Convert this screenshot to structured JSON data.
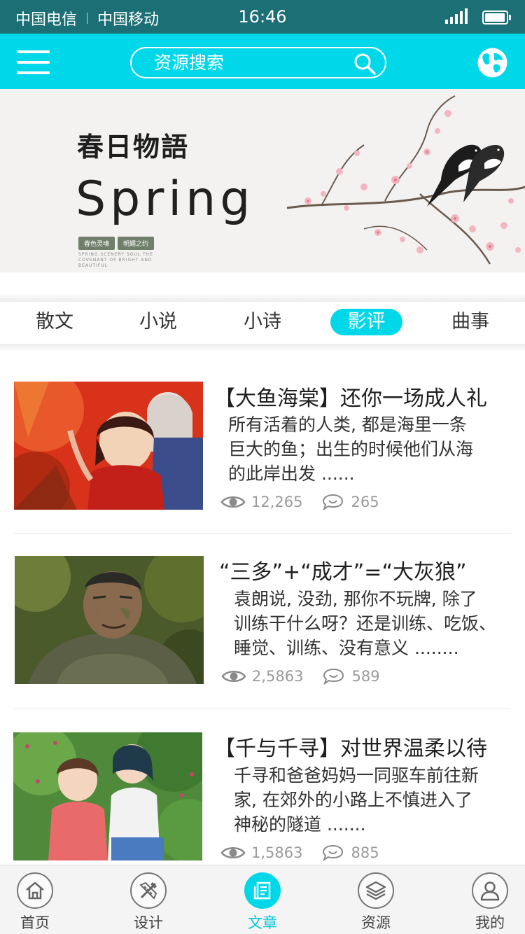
{
  "status_bar": {
    "carrier1": "中国电信",
    "carrier2": "中国移动",
    "time": "16:46",
    "icons": [
      "signal-icon",
      "battery-icon"
    ]
  },
  "header": {
    "search_placeholder": "资源搜索",
    "icons": [
      "menu-icon",
      "search-icon",
      "globe-icon"
    ],
    "accent_color": "#00d8ea"
  },
  "banner": {
    "title_cn": "春日物語",
    "title_en": "Spring",
    "tags": [
      "春色灵魂",
      "明媚之约"
    ],
    "small_text": "SPRING SCENERY SOUL THE COVENANT OF BRIGHT AND BEAUTIFUL"
  },
  "tabs": [
    {
      "label": "散文",
      "active": false
    },
    {
      "label": "小说",
      "active": false
    },
    {
      "label": "小诗",
      "active": false
    },
    {
      "label": "影评",
      "active": true
    },
    {
      "label": "曲事",
      "active": false
    }
  ],
  "articles": [
    {
      "title": "【大鱼海棠】还你一场成人礼",
      "desc": [
        "所有活着的人类, 都是海里一条",
        "巨大的鱼；出生的时候他们从海",
        "的此岸出发 ......"
      ],
      "views": "12,265",
      "comments": "265"
    },
    {
      "title": "“三多”+“成才”=“大灰狼”",
      "desc": [
        "袁朗说, 没劲, 那你不玩牌, 除了",
        "训练干什么呀？还是训练、吃饭、",
        "睡觉、训练、没有意义 ........"
      ],
      "views": "2,5863",
      "comments": "589"
    },
    {
      "title": "【千与千寻】对世界温柔以待",
      "desc": [
        "千寻和爸爸妈妈一同驱车前往新",
        "家, 在郊外的小路上不慎进入了",
        "神秘的隧道 ......."
      ],
      "views": "1,5863",
      "comments": "885"
    }
  ],
  "bottom_nav": [
    {
      "label": "首页",
      "icon": "home-icon",
      "active": false
    },
    {
      "label": "设计",
      "icon": "design-icon",
      "active": false
    },
    {
      "label": "文章",
      "icon": "article-icon",
      "active": true
    },
    {
      "label": "资源",
      "icon": "layers-icon",
      "active": false
    },
    {
      "label": "我的",
      "icon": "user-icon",
      "active": false
    }
  ]
}
